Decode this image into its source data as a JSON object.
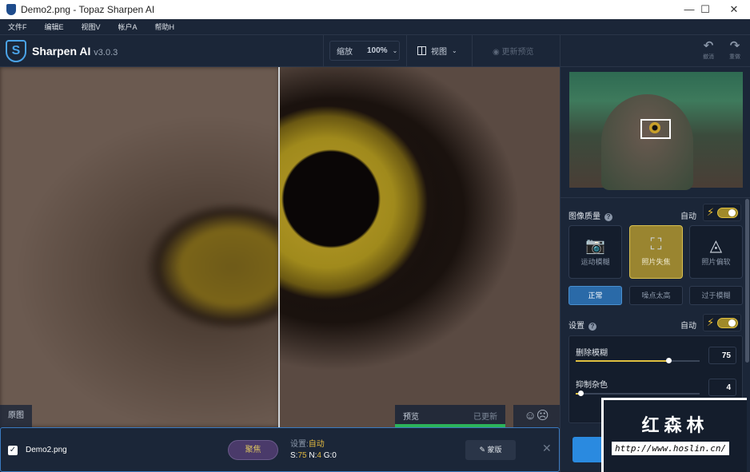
{
  "window": {
    "title": "Demo2.png - Topaz Sharpen AI",
    "minimize": "—",
    "maximize": "☐",
    "close": "✕"
  },
  "menu": [
    "文件F",
    "编辑E",
    "视图V",
    "帐户A",
    "帮助H"
  ],
  "app": {
    "name": "Sharpen AI",
    "version": "v3.0.3",
    "logo": "S"
  },
  "toolbar": {
    "zoom_label": "缩放",
    "zoom_value": "100%",
    "view_label": "视图",
    "update_preview": "更新预览",
    "undo": "撤消",
    "redo": "重做"
  },
  "viewer": {
    "original_label": "原图",
    "preview_label": "预览",
    "preview_status": "已更新",
    "preview_progress": 100
  },
  "quality": {
    "title": "图像质量",
    "auto": "自动",
    "modes": [
      "运动模糊",
      "照片失焦",
      "照片偏软"
    ],
    "selected_mode": "照片失焦",
    "levels": [
      "正常",
      "噪点太高",
      "过于模糊"
    ],
    "selected_level": "正常"
  },
  "settings": {
    "title": "设置",
    "auto": "自动",
    "sliders": [
      {
        "label": "删除模糊",
        "value": "75",
        "fraction": 0.75
      },
      {
        "label": "抑制杂色",
        "value": "4",
        "fraction": 0.04
      }
    ]
  },
  "file": {
    "name": "Demo2.png",
    "mode": "聚焦",
    "settings_label": "设置:",
    "settings_value": "自动",
    "s_label": "S:",
    "s": "75",
    "n_label": "N:",
    "n": "4",
    "g_label": "G:",
    "g": "0",
    "mask": "蒙版",
    "close": "✕"
  },
  "watermark": {
    "title": "红森林",
    "url": "http://www.hoslin.cn/"
  },
  "colors": {
    "accent": "#2a8ae0",
    "gold": "#e0c040",
    "bg": "#1b2638"
  }
}
